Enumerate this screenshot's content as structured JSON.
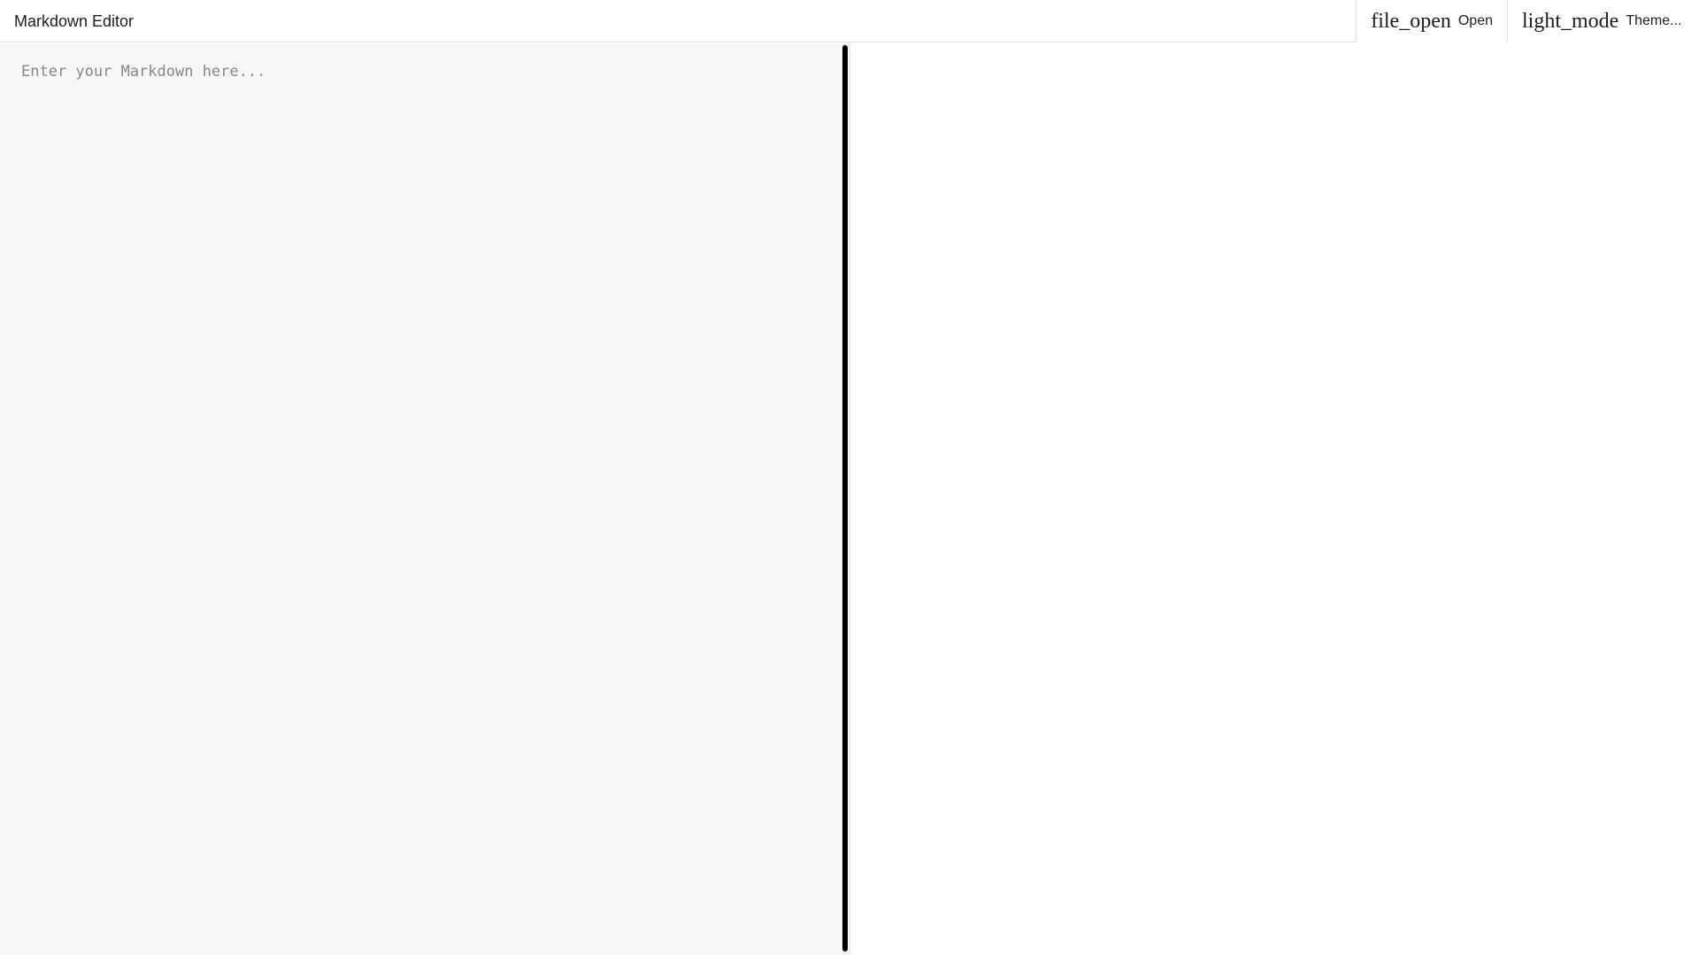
{
  "header": {
    "title": "Markdown Editor"
  },
  "toolbar": {
    "open": {
      "icon_text": "file_open",
      "icon_name": "file-open-icon",
      "label": "Open"
    },
    "theme": {
      "icon_text": "light_mode",
      "icon_name": "light-mode-icon",
      "label": "Theme..."
    }
  },
  "editor": {
    "value": "",
    "placeholder": "Enter your Markdown here..."
  },
  "preview": {
    "content": ""
  },
  "colors": {
    "editor_background": "#f7f7f7",
    "preview_background": "#ffffff",
    "border": "#e2e2e2",
    "scrollbar_thumb": "#000000"
  }
}
